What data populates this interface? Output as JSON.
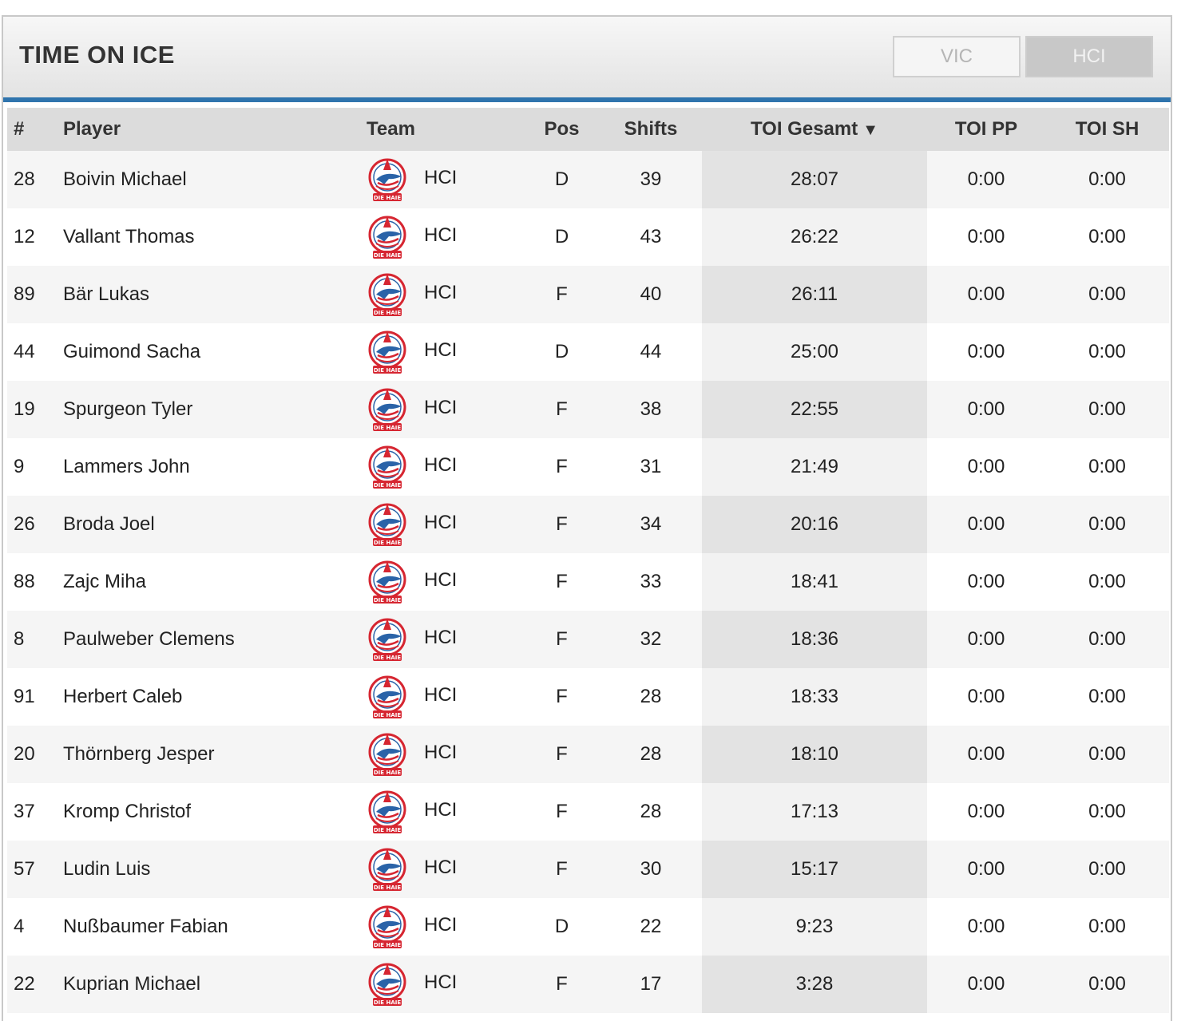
{
  "panel": {
    "title": "TIME ON ICE"
  },
  "team_switch": [
    {
      "label": "VIC",
      "active": false
    },
    {
      "label": "HCI",
      "active": true
    }
  ],
  "table": {
    "columns": {
      "num": "#",
      "player": "Player",
      "team": "Team",
      "pos": "Pos",
      "shifts": "Shifts",
      "toi_total": "TOI Gesamt",
      "sort_indicator": "▼",
      "toi_pp": "TOI PP",
      "toi_sh": "TOI SH"
    },
    "team_logo_text": "DIE HAIE",
    "colors": {
      "accent": "#2f74ad",
      "logo_red": "#d62631",
      "logo_blue": "#2a63a8"
    },
    "rows": [
      {
        "num": "28",
        "player": "Boivin Michael",
        "team": "HCI",
        "pos": "D",
        "shifts": "39",
        "toi_total": "28:07",
        "toi_pp": "0:00",
        "toi_sh": "0:00"
      },
      {
        "num": "12",
        "player": "Vallant Thomas",
        "team": "HCI",
        "pos": "D",
        "shifts": "43",
        "toi_total": "26:22",
        "toi_pp": "0:00",
        "toi_sh": "0:00"
      },
      {
        "num": "89",
        "player": "Bär Lukas",
        "team": "HCI",
        "pos": "F",
        "shifts": "40",
        "toi_total": "26:11",
        "toi_pp": "0:00",
        "toi_sh": "0:00"
      },
      {
        "num": "44",
        "player": "Guimond Sacha",
        "team": "HCI",
        "pos": "D",
        "shifts": "44",
        "toi_total": "25:00",
        "toi_pp": "0:00",
        "toi_sh": "0:00"
      },
      {
        "num": "19",
        "player": "Spurgeon Tyler",
        "team": "HCI",
        "pos": "F",
        "shifts": "38",
        "toi_total": "22:55",
        "toi_pp": "0:00",
        "toi_sh": "0:00"
      },
      {
        "num": "9",
        "player": "Lammers John",
        "team": "HCI",
        "pos": "F",
        "shifts": "31",
        "toi_total": "21:49",
        "toi_pp": "0:00",
        "toi_sh": "0:00"
      },
      {
        "num": "26",
        "player": "Broda Joel",
        "team": "HCI",
        "pos": "F",
        "shifts": "34",
        "toi_total": "20:16",
        "toi_pp": "0:00",
        "toi_sh": "0:00"
      },
      {
        "num": "88",
        "player": "Zajc Miha",
        "team": "HCI",
        "pos": "F",
        "shifts": "33",
        "toi_total": "18:41",
        "toi_pp": "0:00",
        "toi_sh": "0:00"
      },
      {
        "num": "8",
        "player": "Paulweber Clemens",
        "team": "HCI",
        "pos": "F",
        "shifts": "32",
        "toi_total": "18:36",
        "toi_pp": "0:00",
        "toi_sh": "0:00"
      },
      {
        "num": "91",
        "player": "Herbert Caleb",
        "team": "HCI",
        "pos": "F",
        "shifts": "28",
        "toi_total": "18:33",
        "toi_pp": "0:00",
        "toi_sh": "0:00"
      },
      {
        "num": "20",
        "player": "Thörnberg Jesper",
        "team": "HCI",
        "pos": "F",
        "shifts": "28",
        "toi_total": "18:10",
        "toi_pp": "0:00",
        "toi_sh": "0:00"
      },
      {
        "num": "37",
        "player": "Kromp Christof",
        "team": "HCI",
        "pos": "F",
        "shifts": "28",
        "toi_total": "17:13",
        "toi_pp": "0:00",
        "toi_sh": "0:00"
      },
      {
        "num": "57",
        "player": "Ludin Luis",
        "team": "HCI",
        "pos": "F",
        "shifts": "30",
        "toi_total": "15:17",
        "toi_pp": "0:00",
        "toi_sh": "0:00"
      },
      {
        "num": "4",
        "player": "Nußbaumer Fabian",
        "team": "HCI",
        "pos": "D",
        "shifts": "22",
        "toi_total": "9:23",
        "toi_pp": "0:00",
        "toi_sh": "0:00"
      },
      {
        "num": "22",
        "player": "Kuprian Michael",
        "team": "HCI",
        "pos": "F",
        "shifts": "17",
        "toi_total": "3:28",
        "toi_pp": "0:00",
        "toi_sh": "0:00"
      }
    ]
  }
}
